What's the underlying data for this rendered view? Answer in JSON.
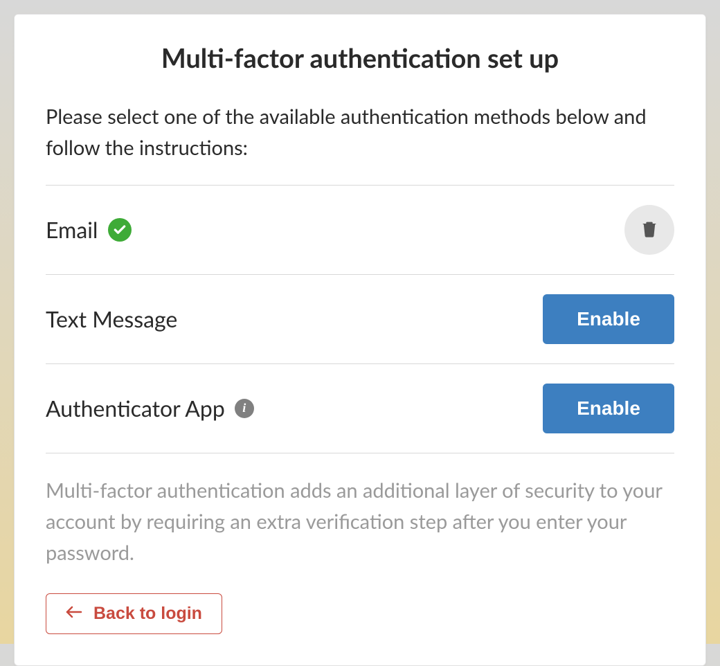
{
  "title": "Multi-factor authentication set up",
  "instructions": "Please select one of the available authentication methods below and follow the instructions:",
  "methods": {
    "email": {
      "label": "Email",
      "enabled": true
    },
    "text": {
      "label": "Text Message",
      "enable_label": "Enable"
    },
    "app": {
      "label": "Authenticator App",
      "enable_label": "Enable"
    }
  },
  "footer": "Multi-factor authentication adds an additional layer of security to your account by requiring an extra verification step after you enter your password.",
  "back_label": "Back to login",
  "colors": {
    "primary_button": "#3d7fc0",
    "danger": "#c94b3f",
    "success": "#3eab37"
  }
}
